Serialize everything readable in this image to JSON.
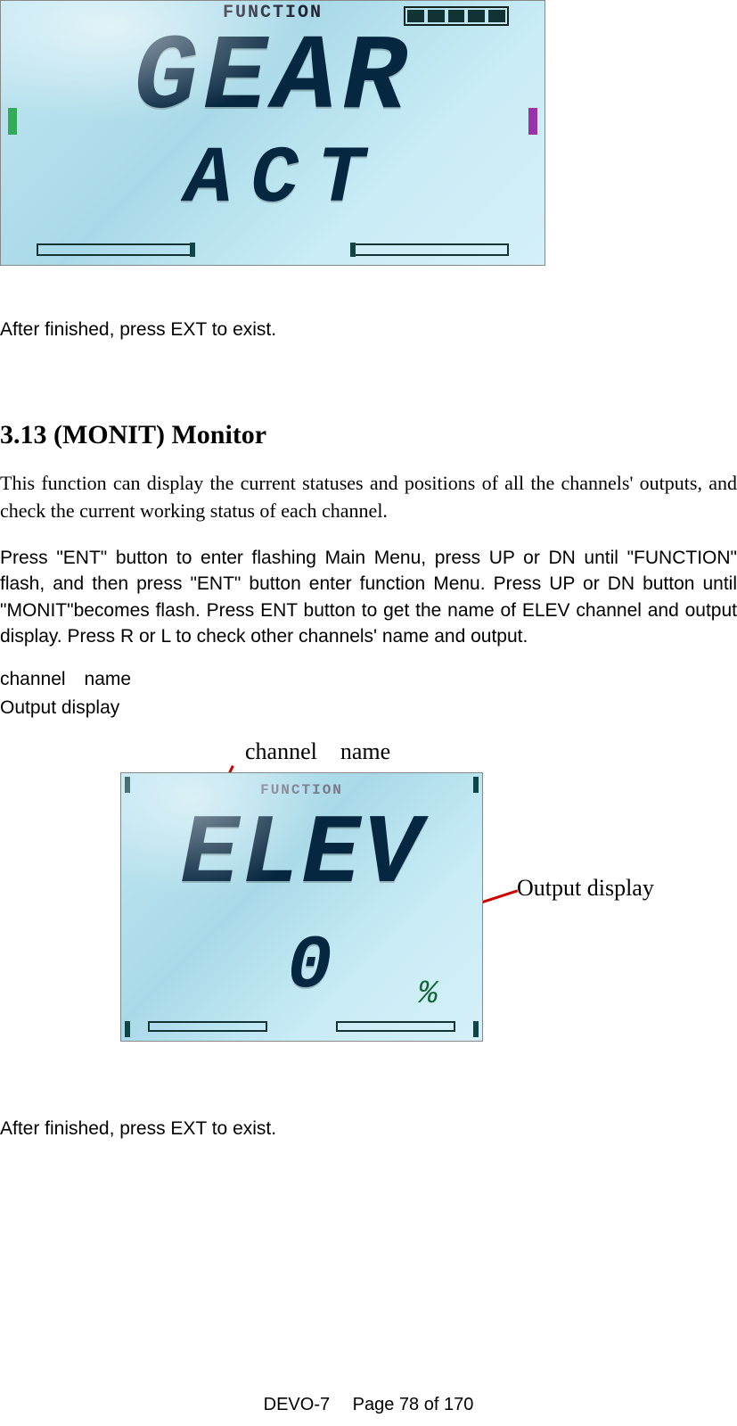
{
  "figure1": {
    "top_label": "FUNCTION",
    "line1": "GEAR",
    "line2": "ACT"
  },
  "text_after_fig1": "After finished, press EXT to exist.",
  "section": {
    "heading": "3.13 (MONIT) Monitor",
    "intro_serif": "This function can display the current statuses and positions of all the channels' outputs, and check the current working status of each channel.",
    "body_sans": "Press \"ENT\" button to enter flashing Main Menu, press UP or DN until \"FUNCTION\" flash, and then press \"ENT\" button enter function Menu. Press UP or DN button until \"MONIT\"becomes flash. Press ENT button to get the name of ELEV channel and output display. Press R or L to check other channels' name and output.",
    "label_channel_name": "channel name",
    "label_output_display": "Output display"
  },
  "figure2": {
    "callout_channel_name": "channel name",
    "callout_output_display": "Output display",
    "top_label": "FUNCTION",
    "line1": "ELEV",
    "value": "0",
    "percent_sign": "%"
  },
  "text_after_fig2": "After finished, press EXT to exist.",
  "footer": "DEVO-7  Page 78 of 170"
}
